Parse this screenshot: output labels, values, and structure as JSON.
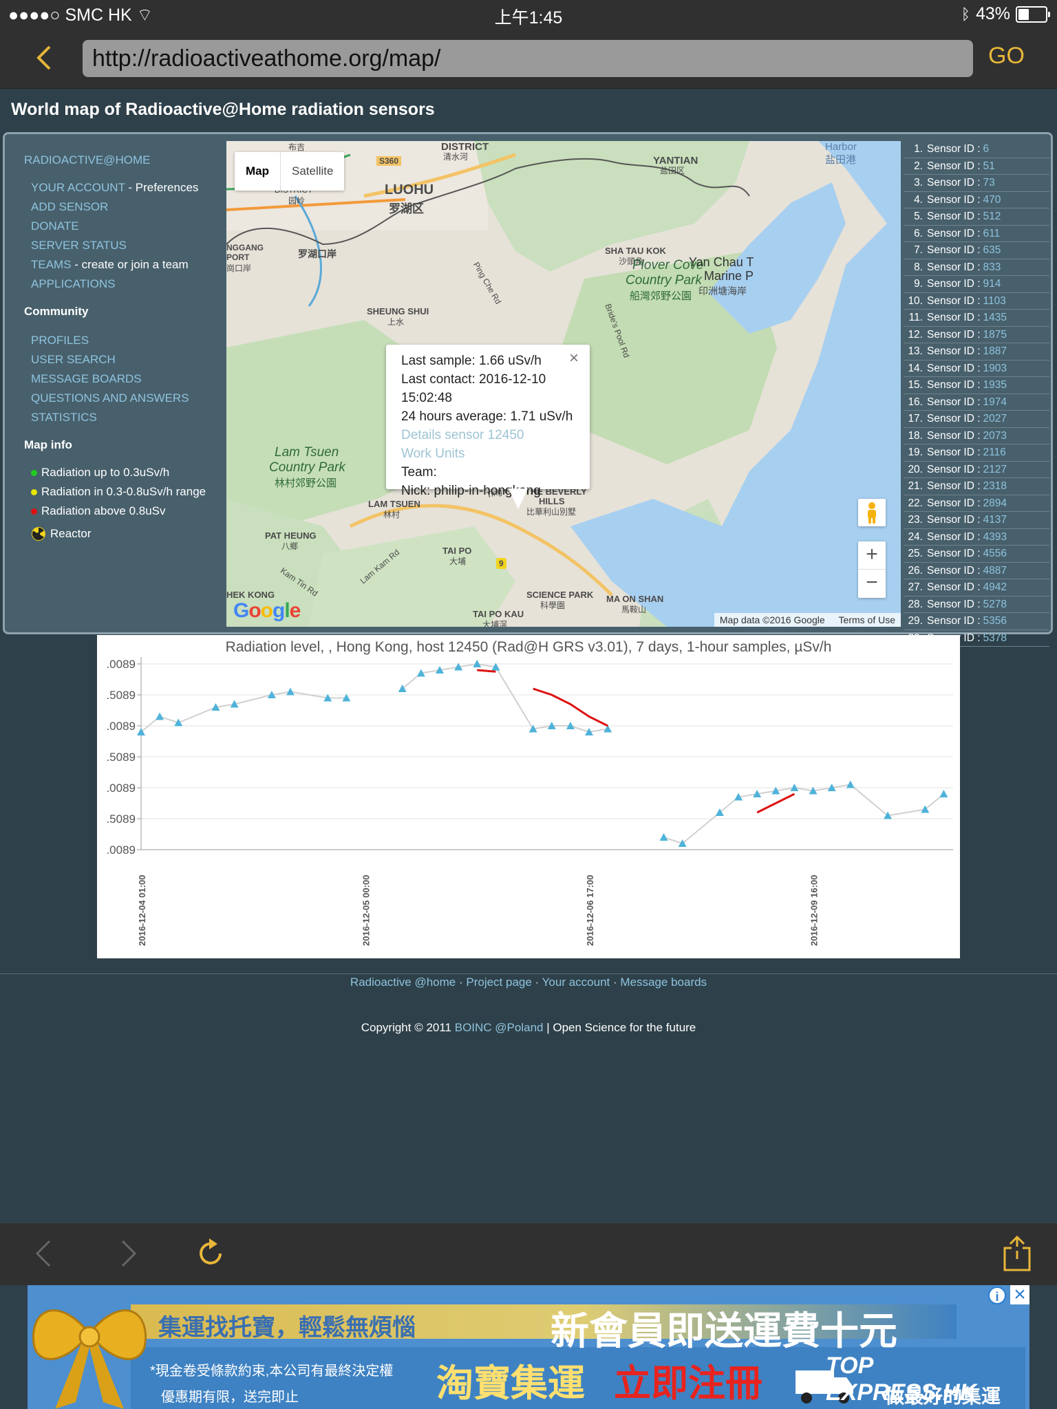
{
  "status": {
    "carrier": "●●●●○ SMC HK",
    "time": "上午1:45",
    "battery": "43%",
    "battery_level": 0.43
  },
  "browser": {
    "url": "http://radioactiveathome.org/map/",
    "go_label": "GO"
  },
  "page": {
    "title": "World map of Radioactive@Home radiation sensors"
  },
  "sidebar": {
    "brand": "RADIOACTIVE@HOME",
    "account": "YOUR ACCOUNT",
    "account_suffix": " - Preferences",
    "add_sensor": "ADD SENSOR",
    "donate": "DONATE",
    "server_status": "SERVER STATUS",
    "teams": "TEAMS",
    "teams_suffix": " - create or join a team",
    "applications": "APPLICATIONS",
    "community_head": "Community",
    "profiles": "PROFILES",
    "user_search": "USER SEARCH",
    "message_boards": "MESSAGE BOARDS",
    "qa": "QUESTIONS AND ANSWERS",
    "statistics": "STATISTICS",
    "mapinfo_head": "Map info",
    "legend": [
      {
        "label": "Radiation up to 0.3uSv/h",
        "color": "#22cc22"
      },
      {
        "label": "Radiation in 0.3-0.8uSv/h range",
        "color": "#e6e600"
      },
      {
        "label": "Radiation above 0.8uSv",
        "color": "#dd1111"
      }
    ],
    "reactor": "Reactor"
  },
  "map": {
    "type_map": "Map",
    "type_satellite": "Satellite",
    "labels": {
      "luohu": "LUOHU",
      "luohu_cn": "罗湖区",
      "district_top": "DISTRICT",
      "district_top_cn": "清水河",
      "district_right": "DISTRICT",
      "district_right_cn": "布吉",
      "district_left": "DISTRICT",
      "district_left_cn": "园岭",
      "yantian": "YANTIAN",
      "yantian_cn": "盐田区",
      "harbor": "Harbor",
      "harbor_cn": "盐田港",
      "s360": "S360",
      "lwhk": "罗湖口岸",
      "sha_tau_kok": "SHA TAU KOK",
      "sha_tau_kok_cn": "沙頭角",
      "ping_che": "Ping Che Rd",
      "plover_cove": "Plover Cove",
      "plover_cove2": "Country Park",
      "plover_cove_cn": "船灣郊野公園",
      "yan_chau": "Yan Chau T",
      "yan_chau2": "Marine P",
      "yan_chau_cn": "印洲塘海岸",
      "brides_pool": "Bride's Pool Rd",
      "sheung_shui": "SHEUNG SHUI",
      "sheung_shui_cn": "上水",
      "nggang": "NGGANG",
      "port": "PORT",
      "port_cn": "崗口岸",
      "lam_tsuen_cp": "Lam Tsuen",
      "lam_tsuen_cp2": "Country Park",
      "lam_tsuen_cp_cn": "林村郊野公園",
      "lam_tsuen": "LAM TSUEN",
      "lam_tsuen_cn": "林村",
      "pat_heung": "PAT HEUNG",
      "pat_heung_cn": "八鄉",
      "kam_tin": "Kam Tin Rd",
      "lam_kam": "Lam Kam Rd",
      "tai_po": "TAI PO",
      "tai_po_cn": "大埔",
      "ting_kok": "Ting Kok Rd",
      "beverly": "THE BEVERLY",
      "beverly2": "HILLS",
      "beverly_cn": "比華利山別墅",
      "science_park": "SCIENCE PARK",
      "science_park_cn": "科學園",
      "ma_on_shan": "MA ON SHAN",
      "ma_on_shan_cn": "馬鞍山",
      "tai_po_kau": "TAI PO KAU",
      "tai_po_kau_cn": "大埔滘",
      "hek_kong": "HEK KONG",
      "route9": "9"
    },
    "popup": {
      "last_sample": "Last sample: 1.66 uSv/h",
      "last_contact": "Last contact: 2016-12-10 15:02:48",
      "avg": "24 hours average: 1.71 uSv/h",
      "details": "Details sensor 12450",
      "work_units": "Work Units",
      "team": "Team:",
      "nick": "Nick: philip-in-hongkong",
      "close": "×"
    },
    "zoom_in": "+",
    "zoom_out": "−",
    "attribution": "Map data ©2016 Google",
    "terms": "Terms of Use",
    "logo": "Google"
  },
  "sensors": [
    {
      "n": "1.",
      "label": "Sensor ID :",
      "id": "6"
    },
    {
      "n": "2.",
      "label": "Sensor ID :",
      "id": "51"
    },
    {
      "n": "3.",
      "label": "Sensor ID :",
      "id": "73"
    },
    {
      "n": "4.",
      "label": "Sensor ID :",
      "id": "470"
    },
    {
      "n": "5.",
      "label": "Sensor ID :",
      "id": "512"
    },
    {
      "n": "6.",
      "label": "Sensor ID :",
      "id": "611"
    },
    {
      "n": "7.",
      "label": "Sensor ID :",
      "id": "635"
    },
    {
      "n": "8.",
      "label": "Sensor ID :",
      "id": "833"
    },
    {
      "n": "9.",
      "label": "Sensor ID :",
      "id": "914"
    },
    {
      "n": "10.",
      "label": "Sensor ID :",
      "id": "1103"
    },
    {
      "n": "11.",
      "label": "Sensor ID :",
      "id": "1435"
    },
    {
      "n": "12.",
      "label": "Sensor ID :",
      "id": "1875"
    },
    {
      "n": "13.",
      "label": "Sensor ID :",
      "id": "1887"
    },
    {
      "n": "14.",
      "label": "Sensor ID :",
      "id": "1903"
    },
    {
      "n": "15.",
      "label": "Sensor ID :",
      "id": "1935"
    },
    {
      "n": "16.",
      "label": "Sensor ID :",
      "id": "1974"
    },
    {
      "n": "17.",
      "label": "Sensor ID :",
      "id": "2027"
    },
    {
      "n": "18.",
      "label": "Sensor ID :",
      "id": "2073"
    },
    {
      "n": "19.",
      "label": "Sensor ID :",
      "id": "2116"
    },
    {
      "n": "20.",
      "label": "Sensor ID :",
      "id": "2127"
    },
    {
      "n": "21.",
      "label": "Sensor ID :",
      "id": "2318"
    },
    {
      "n": "22.",
      "label": "Sensor ID :",
      "id": "2894"
    },
    {
      "n": "23.",
      "label": "Sensor ID :",
      "id": "4137"
    },
    {
      "n": "24.",
      "label": "Sensor ID :",
      "id": "4393"
    },
    {
      "n": "25.",
      "label": "Sensor ID :",
      "id": "4556"
    },
    {
      "n": "26.",
      "label": "Sensor ID :",
      "id": "4887"
    },
    {
      "n": "27.",
      "label": "Sensor ID :",
      "id": "4942"
    },
    {
      "n": "28.",
      "label": "Sensor ID :",
      "id": "5278"
    },
    {
      "n": "29.",
      "label": "Sensor ID :",
      "id": "5356"
    },
    {
      "n": "30.",
      "label": "Sensor ID :",
      "id": "5378"
    }
  ],
  "chart_data": {
    "type": "line",
    "title": "Radiation level,  , Hong Kong,  host 12450 (Rad@H GRS v3.01), 7 days, 1-hour samples, µSv/h",
    "ytick_labels": [
      ".0089",
      ".5089",
      ".0089",
      ".5089",
      ".0089",
      ".5089",
      ".0089"
    ],
    "xtick_labels": [
      "2016-12-04 01:00",
      "2016-12-05 00:00",
      "2016-12-06 17:00",
      "2016-12-09 16:00"
    ],
    "xlim": [
      0,
      30
    ],
    "ylim": [
      0,
      6
    ],
    "grid": true,
    "series": [
      {
        "style": "markers",
        "color": "#4fb3d9",
        "x": [
          0,
          1,
          2,
          4,
          5,
          7,
          8,
          10,
          11,
          14,
          15,
          16,
          17,
          18,
          19,
          20,
          22,
          23,
          24,
          25,
          26,
          28,
          29,
          31,
          32,
          33,
          34,
          35,
          36,
          37,
          38,
          40,
          41,
          43
        ],
        "y": [
          3.8,
          4.3,
          4.1,
          4.6,
          4.7,
          5.0,
          5.1,
          4.9,
          4.9,
          5.2,
          5.7,
          5.8,
          5.9,
          6.0,
          5.9,
          3.9,
          4.0,
          4.0,
          3.8,
          3.9,
          0.4,
          0.2,
          1.2,
          1.7,
          1.8,
          1.9,
          2.0,
          1.9,
          2.0,
          2.1,
          1.1,
          1.3,
          1.8,
          4.2
        ],
        "shown_x": [
          0,
          1,
          2,
          4,
          5,
          7,
          8,
          10,
          11,
          14,
          15,
          16,
          17,
          18,
          19,
          21,
          22,
          23,
          24,
          25,
          28,
          29,
          31,
          32,
          33,
          34,
          35,
          36,
          37,
          38,
          40,
          42,
          43
        ]
      },
      {
        "style": "line",
        "color": "#dd1111",
        "segments": [
          {
            "x": [
              18,
              19
            ],
            "y": [
              5.8,
              5.75
            ]
          },
          {
            "x": [
              21,
              22,
              23,
              24,
              25
            ],
            "y": [
              5.2,
              5.0,
              4.7,
              4.3,
              4.0
            ]
          },
          {
            "x": [
              33,
              34,
              35
            ],
            "y": [
              1.2,
              1.5,
              1.8
            ]
          }
        ]
      }
    ]
  },
  "footer": {
    "link1": "Radioactive @home",
    "link2": "Project page",
    "link3": "Your account",
    "link4": "Message boards",
    "sep": " · ",
    "copyright_pre": "Copyright © 2011 ",
    "copyright_link": "BOINC @Poland",
    "copyright_post": " | Open Science for the future"
  },
  "ad": {
    "line1": "集運找托寶，輕鬆無煩惱",
    "line2": "新會員即送運費十元",
    "note1": "*現金卷受條款約束,本公司有最終決定權",
    "note2": "優惠期有限，送完即止",
    "brand": "淘寶集運",
    "cta": "立即注冊",
    "logo": "TOP EXPRESS.HK",
    "slogan": "做最好的集運",
    "info": "i",
    "close": "×"
  }
}
